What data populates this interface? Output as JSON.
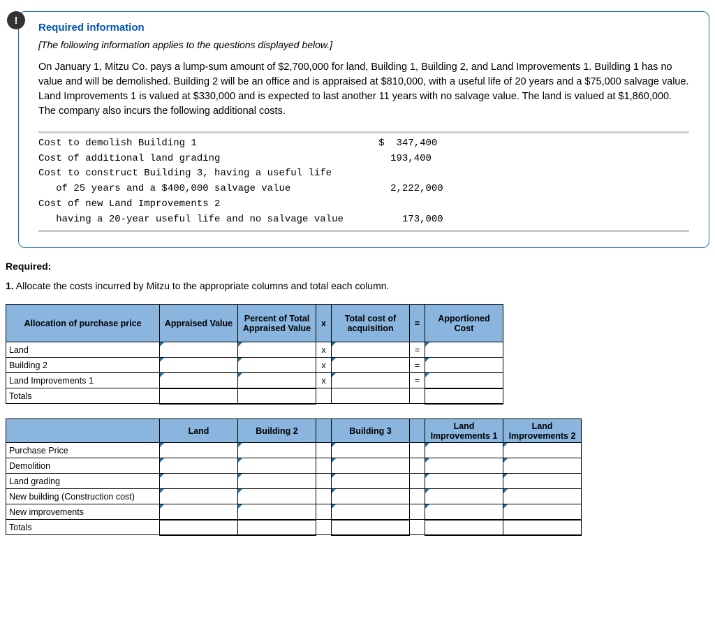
{
  "badge": "!",
  "info": {
    "title": "Required information",
    "subtitle": "[The following information applies to the questions displayed below.]",
    "body": "On January 1, Mitzu Co. pays a lump-sum amount of $2,700,000 for land, Building 1, Building 2, and Land Improvements 1. Building 1 has no value and will be demolished. Building 2 will be an office and is appraised at $810,000, with a useful life of 20 years and a $75,000 salvage value. Land Improvements 1 is valued at $330,000 and is expected to last another 11 years with no salvage value. The land is valued at $1,860,000. The company also incurs the following additional costs."
  },
  "costs": {
    "l1": "Cost to demolish Building 1",
    "v1": "$  347,400",
    "l2": "Cost of additional land grading",
    "v2": "193,400",
    "l3a": "Cost to construct Building 3, having a useful life",
    "l3b": "   of 25 years and a $400,000 salvage value",
    "v3": "2,222,000",
    "l4a": "Cost of new Land Improvements 2",
    "l4b": "   having a 20-year useful life and no salvage value",
    "v4": "173,000"
  },
  "required": {
    "heading": "Required:",
    "q1": "1. Allocate the costs incurred by Mitzu to the appropriate columns and total each column."
  },
  "table1": {
    "h_alloc": "Allocation of purchase price",
    "h_appraised": "Appraised Value",
    "h_percent": "Percent of Total Appraised Value",
    "h_x": "x",
    "h_totcost": "Total cost of acquisition",
    "h_eq": "=",
    "h_apportioned": "Apportioned Cost",
    "rows": [
      "Land",
      "Building 2",
      "Land Improvements 1",
      "Totals"
    ],
    "x": "x",
    "eq": "="
  },
  "table2": {
    "h_land": "Land",
    "h_b2": "Building 2",
    "h_b3": "Building 3",
    "h_li1": "Land Improvements 1",
    "h_li2": "Land Improvements 2",
    "rows": [
      "Purchase Price",
      "Demolition",
      "Land grading",
      "New building (Construction cost)",
      "New improvements",
      "Totals"
    ]
  }
}
